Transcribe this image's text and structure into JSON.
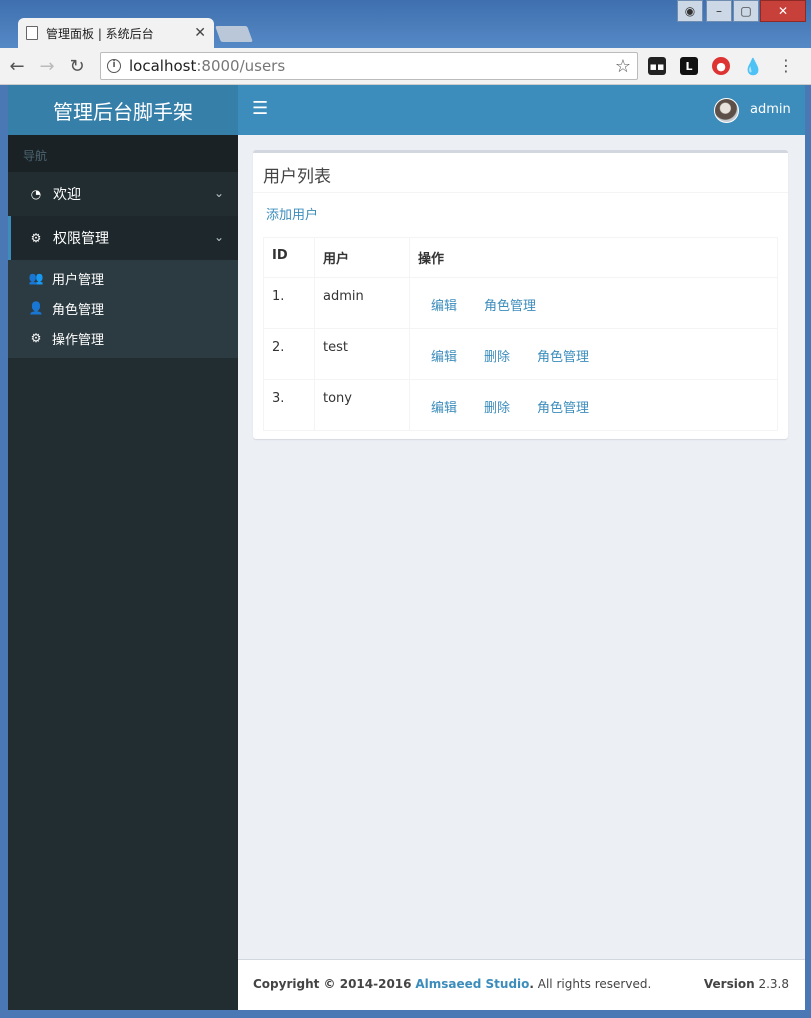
{
  "browser": {
    "tab_title": "管理面板 | 系统后台",
    "url_host": "localhost",
    "url_path": ":8000/users"
  },
  "app": {
    "logo": "管理后台脚手架",
    "user_name": "admin"
  },
  "sidebar": {
    "header": "导航",
    "items": [
      {
        "label": "欢迎"
      },
      {
        "label": "权限管理"
      }
    ],
    "subitems": [
      {
        "label": "用户管理"
      },
      {
        "label": "角色管理"
      },
      {
        "label": "操作管理"
      }
    ]
  },
  "box": {
    "title": "用户列表",
    "add_link": "添加用户",
    "columns": [
      "ID",
      "用户",
      "操作"
    ],
    "rows": [
      {
        "id": "1.",
        "user": "admin",
        "ops": [
          "编辑",
          "角色管理"
        ]
      },
      {
        "id": "2.",
        "user": "test",
        "ops": [
          "编辑",
          "删除",
          "角色管理"
        ]
      },
      {
        "id": "3.",
        "user": "tony",
        "ops": [
          "编辑",
          "删除",
          "角色管理"
        ]
      }
    ]
  },
  "footer": {
    "copyright": "Copyright © 2014-2016",
    "brand": "Almsaeed Studio",
    "period": ".",
    "rights": " All rights reserved.",
    "version_label": "Version",
    "version": " 2.3.8"
  }
}
